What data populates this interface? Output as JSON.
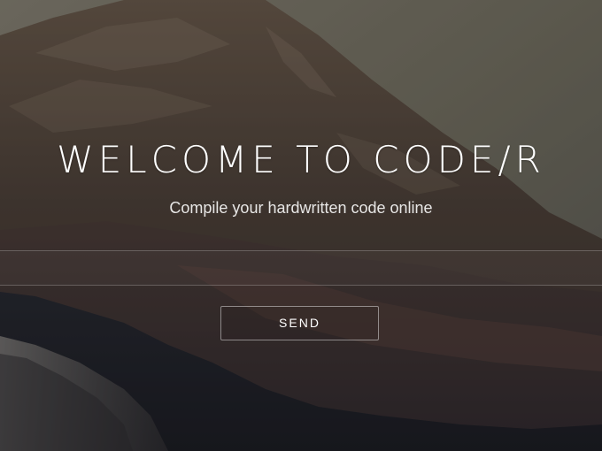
{
  "hero": {
    "title": "WELCOME TO CODE/R",
    "subtitle": "Compile your hardwritten code online"
  },
  "form": {
    "input_value": "",
    "input_placeholder": "",
    "send_label": "SEND"
  },
  "colors": {
    "text": "#ffffff",
    "sky": "#7b7766",
    "mountain": "#4f4236",
    "foothills": "#3a2e2c",
    "forest": "#1f2126"
  }
}
